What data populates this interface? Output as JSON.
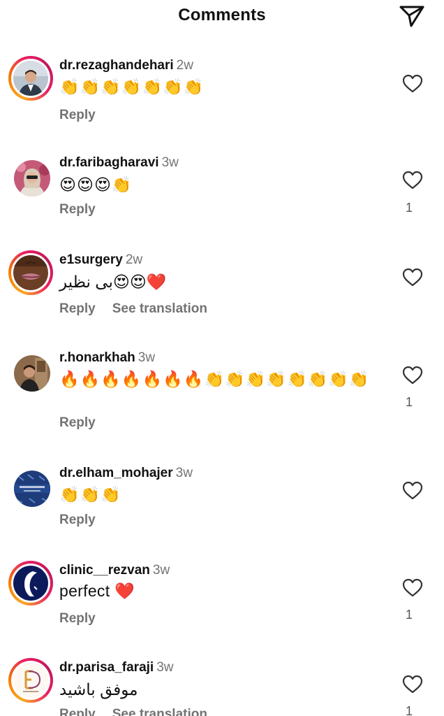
{
  "header": {
    "title": "Comments",
    "share_icon": "paper-plane-icon"
  },
  "comments": [
    {
      "username": "dr.rezaghandehari",
      "time": "2w",
      "text": "👏👏👏👏👏👏👏",
      "reply_label": "Reply",
      "likes": ""
    },
    {
      "username": "dr.faribagharavi",
      "time": "3w",
      "text": "😍😍😍👏",
      "reply_label": "Reply",
      "likes": "1"
    },
    {
      "username": "e1surgery",
      "time": "2w",
      "text": "بی نظیر😍😍❤️",
      "reply_label": "Reply",
      "translation_label": "See translation",
      "likes": ""
    },
    {
      "username": "r.honarkhah",
      "time": "3w",
      "text": "🔥🔥🔥🔥🔥🔥🔥👏👏👏👏👏👏👏👏",
      "reply_label": "Reply",
      "likes": "1"
    },
    {
      "username": "dr.elham_mohajer",
      "time": "3w",
      "text": "👏👏👏",
      "reply_label": "Reply",
      "likes": ""
    },
    {
      "username": "clinic__rezvan",
      "time": "3w",
      "text": "perfect ❤️",
      "reply_label": "Reply",
      "likes": "1"
    },
    {
      "username": "dr.parisa_faraji",
      "time": "3w",
      "text": "موفق باشید",
      "reply_label": "Reply",
      "translation_label": "See translation",
      "likes": "1"
    }
  ],
  "icons": {
    "like": "heart-outline-icon"
  }
}
